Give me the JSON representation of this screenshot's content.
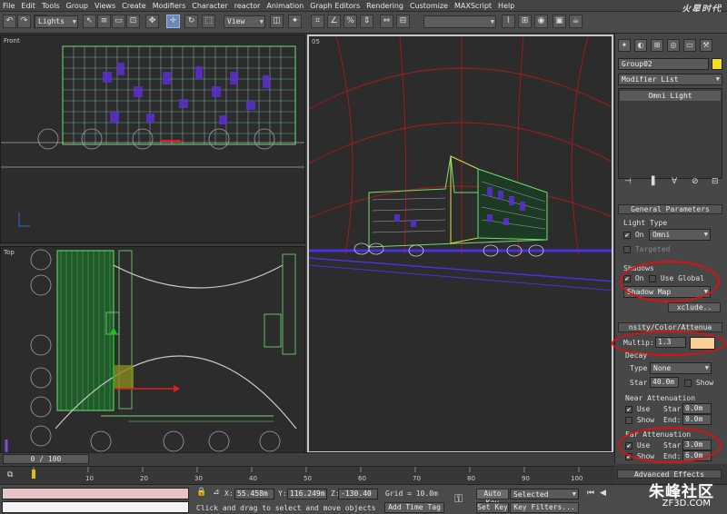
{
  "menu": [
    "File",
    "Edit",
    "Tools",
    "Group",
    "Views",
    "Create",
    "Modifiers",
    "Character",
    "reactor",
    "Animation",
    "Graph Editors",
    "Rendering",
    "Customize",
    "MAXScript",
    "Help"
  ],
  "logo_text": "火星时代",
  "toolbar": {
    "selection_filter": "Lights",
    "ref_coord": "View"
  },
  "viewports": {
    "front_label": "Front",
    "top_label": "Top",
    "persp_label": "05"
  },
  "command_panel": {
    "object_name": "Group02",
    "object_color": "#f0e020",
    "modifier_list": "Modifier List",
    "stack_item": "Omni Light",
    "general_params": {
      "header": "General Parameters",
      "light_type_label": "Light Type",
      "on_label": "On",
      "light_type_value": "Omni",
      "targeted_label": "Targeted",
      "shadows_label": "Shadows",
      "shadow_on_label": "On",
      "use_global_label": "Use Global",
      "shadow_type": "Shadow Map",
      "exclude_label": "xclude.."
    },
    "intensity": {
      "header": "nsity/Color/Attenua",
      "multiplier_label": "Multip:",
      "multiplier_value": "1.3",
      "color": "#f9cf9a",
      "decay_label": "Decay",
      "type_label": "Type",
      "decay_type": "None",
      "start_label": "Star",
      "start_value": "40.0m",
      "show_label": "Show",
      "near_header": "Near Attenuation",
      "near_use": "Use",
      "near_start_label": "Star",
      "near_start": "0.0m",
      "near_show": "Show",
      "near_end_label": "End:",
      "near_end": "0.0m",
      "far_header": "Far Attenuation",
      "far_use": "Use",
      "far_start_label": "Star",
      "far_start": "3.0m",
      "far_show": "Show",
      "far_end_label": "End:",
      "far_end": "6.0m",
      "advanced_header": "Advanced Effects"
    }
  },
  "timeline": {
    "frame_display": "0 / 100",
    "ticks": [
      "0",
      "10",
      "20",
      "30",
      "40",
      "50",
      "60",
      "70",
      "80",
      "90",
      "100"
    ]
  },
  "status": {
    "x_label": "X:",
    "x_value": "55.458m",
    "y_label": "Y:",
    "y_value": "116.249m",
    "z_label": "Z:",
    "z_value": "-130.40",
    "grid": "Grid = 10.0m",
    "prompt": "Click and drag to select and move objects",
    "add_time_tag": "Add Time Tag",
    "auto_key": "Auto Key",
    "set_key": "Set Key",
    "key_mode": "Selected",
    "key_filters": "Key Filters..."
  },
  "watermark": "朱峰社区",
  "watermark_url": "ZF3D.COM"
}
